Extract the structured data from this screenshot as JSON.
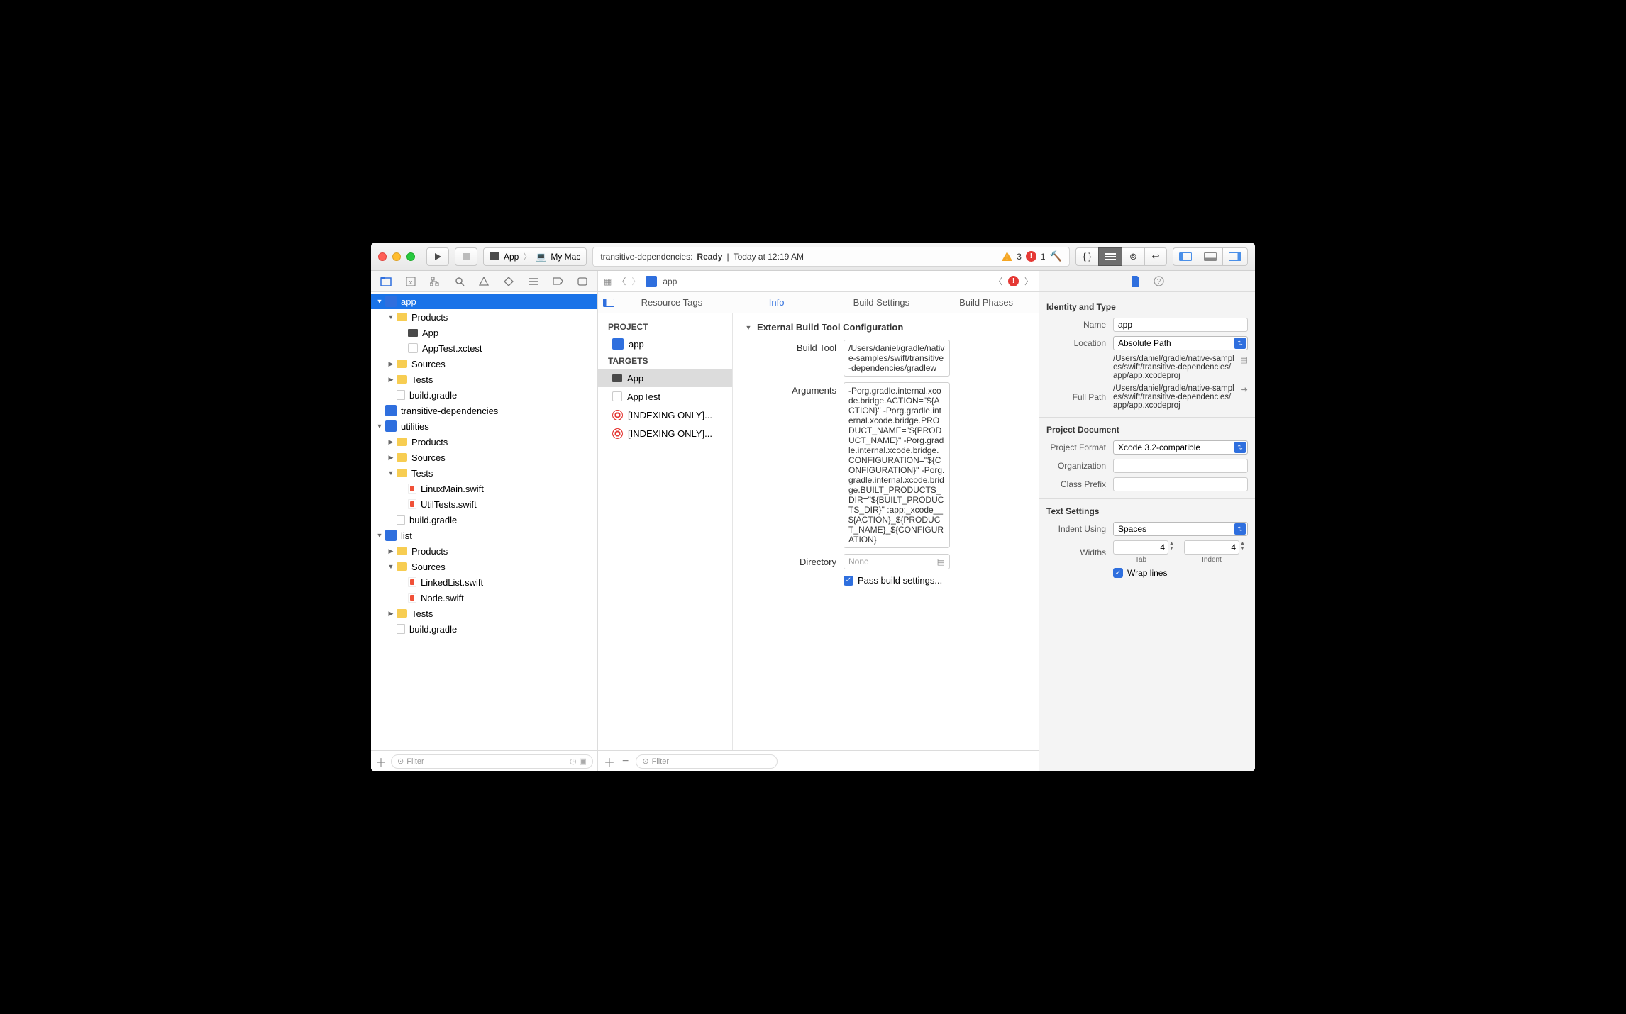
{
  "titlebar": {
    "scheme_target": "App",
    "scheme_dest": "My Mac",
    "status_project": "transitive-dependencies:",
    "status_state": "Ready",
    "status_sep": " | ",
    "status_time": "Today at 12:19 AM",
    "warn_count": "3",
    "err_count": "1"
  },
  "navigator": {
    "tree": [
      {
        "level": 0,
        "disc": "open",
        "icon": "proj",
        "label": "app",
        "selected": true
      },
      {
        "level": 1,
        "disc": "open",
        "icon": "folder",
        "label": "Products"
      },
      {
        "level": 2,
        "disc": "",
        "icon": "exec",
        "label": "App"
      },
      {
        "level": 2,
        "disc": "",
        "icon": "xctest",
        "label": "AppTest.xctest"
      },
      {
        "level": 1,
        "disc": "closed",
        "icon": "folder",
        "label": "Sources"
      },
      {
        "level": 1,
        "disc": "closed",
        "icon": "folder",
        "label": "Tests"
      },
      {
        "level": 1,
        "disc": "",
        "icon": "file",
        "label": "build.gradle"
      },
      {
        "level": 0,
        "disc": "",
        "icon": "proj",
        "label": "transitive-dependencies"
      },
      {
        "level": 0,
        "disc": "open",
        "icon": "proj",
        "label": "utilities"
      },
      {
        "level": 1,
        "disc": "closed",
        "icon": "folder",
        "label": "Products"
      },
      {
        "level": 1,
        "disc": "closed",
        "icon": "folder",
        "label": "Sources"
      },
      {
        "level": 1,
        "disc": "open",
        "icon": "folder",
        "label": "Tests"
      },
      {
        "level": 2,
        "disc": "",
        "icon": "swift",
        "label": "LinuxMain.swift"
      },
      {
        "level": 2,
        "disc": "",
        "icon": "swift",
        "label": "UtilTests.swift"
      },
      {
        "level": 1,
        "disc": "",
        "icon": "file",
        "label": "build.gradle"
      },
      {
        "level": 0,
        "disc": "open",
        "icon": "proj",
        "label": "list"
      },
      {
        "level": 1,
        "disc": "closed",
        "icon": "folder",
        "label": "Products"
      },
      {
        "level": 1,
        "disc": "open",
        "icon": "folder",
        "label": "Sources"
      },
      {
        "level": 2,
        "disc": "",
        "icon": "swift",
        "label": "LinkedList.swift"
      },
      {
        "level": 2,
        "disc": "",
        "icon": "swift",
        "label": "Node.swift"
      },
      {
        "level": 1,
        "disc": "closed",
        "icon": "folder",
        "label": "Tests"
      },
      {
        "level": 1,
        "disc": "",
        "icon": "file",
        "label": "build.gradle"
      }
    ],
    "filter_placeholder": "Filter"
  },
  "editor": {
    "jumpbar_item": "app",
    "tabs": [
      "Resource Tags",
      "Info",
      "Build Settings",
      "Build Phases"
    ],
    "active_tab": 1,
    "project_header": "PROJECT",
    "targets_header": "TARGETS",
    "project_item": "app",
    "targets": [
      {
        "icon": "exec",
        "label": "App",
        "sel": true
      },
      {
        "icon": "xctest",
        "label": "AppTest"
      },
      {
        "icon": "target",
        "label": "[INDEXING ONLY]..."
      },
      {
        "icon": "target",
        "label": "[INDEXING ONLY]..."
      }
    ],
    "section_title": "External Build Tool Configuration",
    "build_tool_label": "Build Tool",
    "build_tool_value": "/Users/daniel/gradle/native-samples/swift/transitive-dependencies/gradlew",
    "arguments_label": "Arguments",
    "arguments_value": "-Porg.gradle.internal.xcode.bridge.ACTION=\"${ACTION}\" -Porg.gradle.internal.xcode.bridge.PRODUCT_NAME=\"${PRODUCT_NAME}\" -Porg.gradle.internal.xcode.bridge.CONFIGURATION=\"${CONFIGURATION}\" -Porg.gradle.internal.xcode.bridge.BUILT_PRODUCTS_DIR=\"${BUILT_PRODUCTS_DIR}\" :app:_xcode__${ACTION}_${PRODUCT_NAME}_${CONFIGURATION}",
    "directory_label": "Directory",
    "directory_placeholder": "None",
    "pass_settings_label": "Pass build settings...",
    "filter_placeholder": "Filter"
  },
  "inspector": {
    "identity_header": "Identity and Type",
    "name_label": "Name",
    "name_value": "app",
    "location_label": "Location",
    "location_select": "Absolute Path",
    "location_path": "/Users/daniel/gradle/native-samples/swift/transitive-dependencies/app/app.xcodeproj",
    "fullpath_label": "Full Path",
    "fullpath_value": "/Users/daniel/gradle/native-samples/swift/transitive-dependencies/app/app.xcodeproj",
    "projdoc_header": "Project Document",
    "format_label": "Project Format",
    "format_value": "Xcode 3.2-compatible",
    "org_label": "Organization",
    "prefix_label": "Class Prefix",
    "text_header": "Text Settings",
    "indent_label": "Indent Using",
    "indent_value": "Spaces",
    "widths_label": "Widths",
    "tab_value": "4",
    "indent_width_value": "4",
    "tab_caption": "Tab",
    "indent_caption": "Indent",
    "wrap_label": "Wrap lines"
  }
}
